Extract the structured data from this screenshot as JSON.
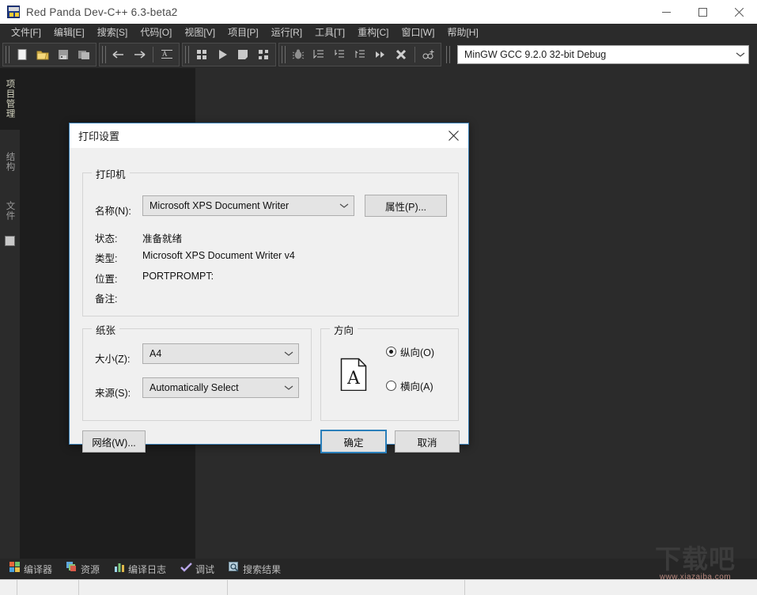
{
  "window": {
    "title": "Red Panda Dev-C++ 6.3-beta2",
    "app_icon": "dev-cpp-icon",
    "controls": [
      {
        "name": "minimize-button",
        "glyph": "minimize-icon"
      },
      {
        "name": "maximize-button",
        "glyph": "maximize-icon"
      },
      {
        "name": "close-button",
        "glyph": "close-icon"
      }
    ]
  },
  "menubar": {
    "items": [
      {
        "label": "文件[F]",
        "name": "menu-file"
      },
      {
        "label": "编辑[E]",
        "name": "menu-edit"
      },
      {
        "label": "搜索[S]",
        "name": "menu-search"
      },
      {
        "label": "代码[O]",
        "name": "menu-code"
      },
      {
        "label": "视图[V]",
        "name": "menu-view"
      },
      {
        "label": "项目[P]",
        "name": "menu-project"
      },
      {
        "label": "运行[R]",
        "name": "menu-run"
      },
      {
        "label": "工具[T]",
        "name": "menu-tools"
      },
      {
        "label": "重构[C]",
        "name": "menu-refactor"
      },
      {
        "label": "窗口[W]",
        "name": "menu-window"
      },
      {
        "label": "帮助[H]",
        "name": "menu-help"
      }
    ]
  },
  "toolbar": {
    "compiler_set": "MinGW GCC 9.2.0 32-bit Debug",
    "buttons": [
      "new-file-icon",
      "open-folder-icon",
      "save-icon",
      "save-all-icon",
      "back-arrow-icon",
      "forward-arrow-icon",
      "format-code-icon",
      "compile-icon",
      "run-icon",
      "stop-icon",
      "compile-run-icon",
      "debug-bug-icon",
      "step-over-icon",
      "step-into-icon",
      "step-out-icon",
      "continue-icon",
      "stop-debug-icon",
      "add-watch-icon"
    ]
  },
  "sidebar": {
    "tabs": [
      {
        "label": "项目管理",
        "name": "sidebar-tab-project",
        "active": true
      },
      {
        "label": "结构",
        "name": "sidebar-tab-structure",
        "active": false
      },
      {
        "label": "文件",
        "name": "sidebar-tab-files",
        "active": false
      }
    ]
  },
  "bottom_tabs": [
    {
      "label": "编译器",
      "name": "bottom-tab-compiler",
      "icon": "compiler-icon"
    },
    {
      "label": "资源",
      "name": "bottom-tab-resources",
      "icon": "resource-icon"
    },
    {
      "label": "编译日志",
      "name": "bottom-tab-compile-log",
      "icon": "log-chart-icon"
    },
    {
      "label": "调试",
      "name": "bottom-tab-debug",
      "icon": "check-icon"
    },
    {
      "label": "搜索结果",
      "name": "bottom-tab-search-results",
      "icon": "search-icon"
    }
  ],
  "watermark": {
    "big": "下载吧",
    "small": "www.xiazaiba.com"
  },
  "dialog": {
    "title": "打印设置",
    "close_label": "✕",
    "printer_group": {
      "title": "打印机",
      "name_label": "名称(N):",
      "name_value": "Microsoft XPS Document Writer",
      "properties_button": "属性(P)...",
      "status_label": "状态:",
      "status_value": "准备就绪",
      "type_label": "类型:",
      "type_value": "Microsoft XPS Document Writer v4",
      "location_label": "位置:",
      "location_value": "PORTPROMPT:",
      "comment_label": "备注:",
      "comment_value": ""
    },
    "paper_group": {
      "title": "纸张",
      "size_label": "大小(Z):",
      "size_value": "A4",
      "source_label": "来源(S):",
      "source_value": "Automatically Select"
    },
    "orientation_group": {
      "title": "方向",
      "portrait_label": "纵向(O)",
      "landscape_label": "横向(A)",
      "selected": "portrait",
      "preview_letter": "A"
    },
    "buttons": {
      "network": "网络(W)...",
      "ok": "确定",
      "cancel": "取消"
    }
  },
  "colors": {
    "accent": "#2a7fba",
    "window_bg": "#2b2b2b",
    "panel_bg": "#1d1d1d",
    "dialog_bg": "#f0f0f0",
    "titlebar_bg": "#ffffff"
  }
}
